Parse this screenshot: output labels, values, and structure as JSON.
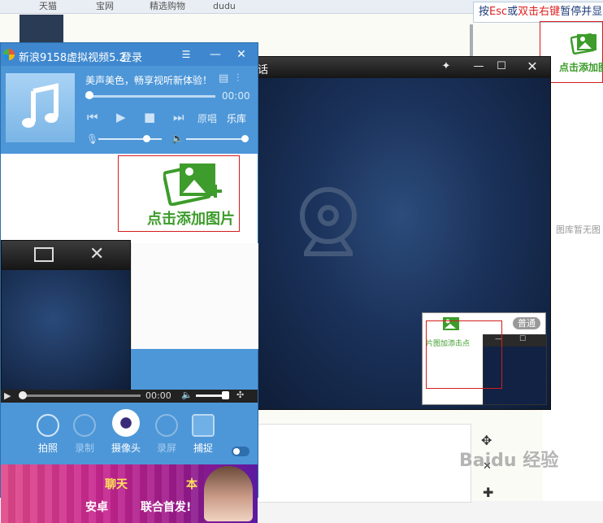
{
  "browser": {
    "tabs": [
      "天猫",
      "宝网",
      "精选购物",
      "dudu"
    ],
    "hint_part1": "按",
    "hint_key1": "Esc",
    "hint_part2": "或",
    "hint_key2": "双击右键",
    "hint_part3": "暂停并显",
    "side_empty_text": "图库暂无图"
  },
  "big_window": {
    "title": "话",
    "preview_badge": "普通",
    "add_picture_label": "点击添加图片",
    "add_picture_label_short": "点击添加图",
    "add_picture_mirror": "片图加添击点"
  },
  "panel": {
    "title": "新浪9158虚拟视频5.2",
    "login": "登录",
    "song_title": "美声美色，畅享视听新体验！",
    "song_time": "00:00",
    "controls": {
      "original": "原唱",
      "library": "乐库"
    },
    "add_picture_label": "点击添加图片",
    "play_time": "00:00",
    "tools": [
      {
        "label": "拍照",
        "icon": "camera-icon"
      },
      {
        "label": "录制",
        "icon": "record-icon"
      },
      {
        "label": "摄像头",
        "icon": "webcam-icon"
      },
      {
        "label": "录屏",
        "icon": "screen-record-icon"
      },
      {
        "label": "捕捉",
        "icon": "capture-icon"
      }
    ],
    "ad": {
      "line1": "聊天",
      "line1_end": "本",
      "line2": "安卓",
      "line2_end": "联合首发!"
    }
  },
  "watermark": "Baidu 经验",
  "colors": {
    "panel_blue": "#4d97d8",
    "add_green": "#3d9c2b",
    "highlight_red": "#d21d1d"
  }
}
